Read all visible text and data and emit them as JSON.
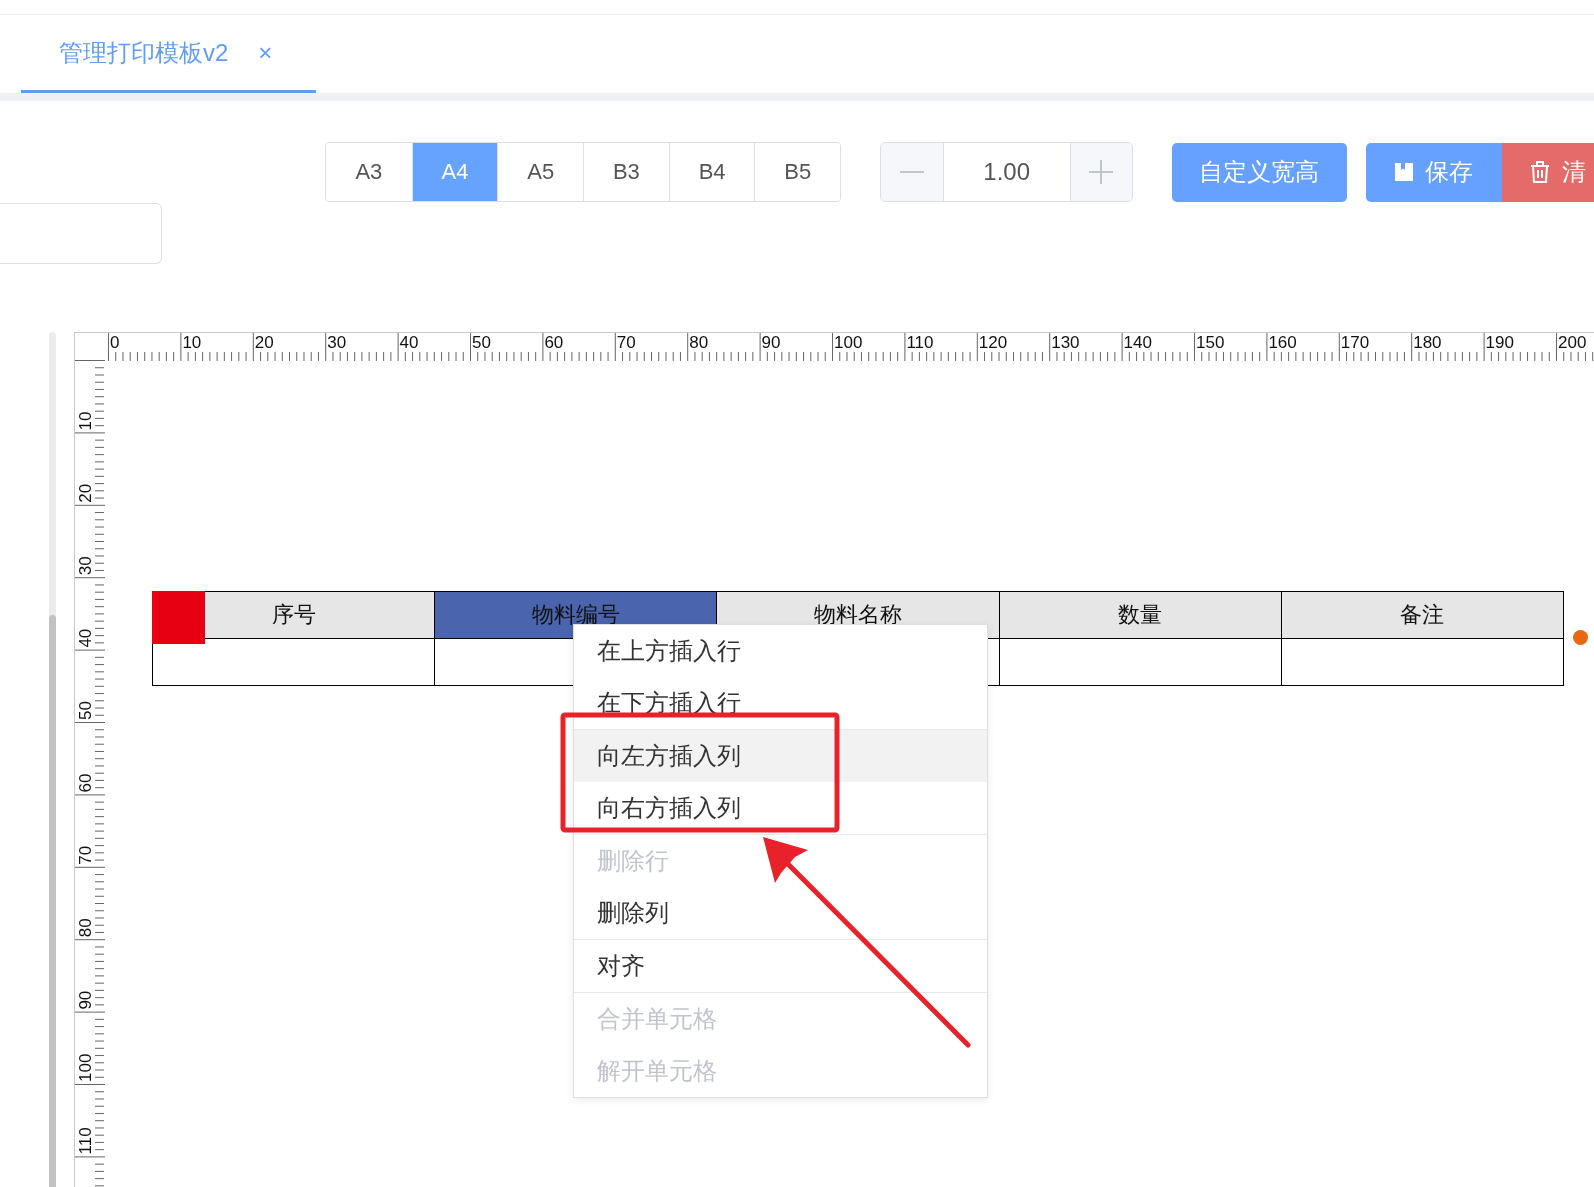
{
  "tabs": [
    {
      "label": "管理打印模板v2",
      "close": "×",
      "selected": true
    }
  ],
  "paper_sizes": [
    {
      "label": "A3",
      "selected": false
    },
    {
      "label": "A4",
      "selected": true
    },
    {
      "label": "A5",
      "selected": false
    },
    {
      "label": "B3",
      "selected": false
    },
    {
      "label": "B4",
      "selected": false
    },
    {
      "label": "B5",
      "selected": false
    }
  ],
  "scale": {
    "value": "1.00"
  },
  "buttons": [
    {
      "kind": "primary",
      "label": "自定义宽高"
    },
    {
      "kind": "save",
      "label": "保存"
    },
    {
      "kind": "clear",
      "label": "清"
    }
  ],
  "ruler": {
    "top_labels": [
      "0",
      "10",
      "20",
      "30",
      "40",
      "50",
      "60",
      "70",
      "80",
      "90",
      "100",
      "110",
      "120",
      "130",
      "140",
      "150",
      "160",
      "170",
      "180",
      "190",
      "200"
    ],
    "left_labels": [
      "10",
      "20",
      "30",
      "40",
      "50",
      "60",
      "70",
      "80",
      "90",
      "100",
      "110"
    ]
  },
  "table": {
    "columns": [
      {
        "label": "序号",
        "selected": false
      },
      {
        "label": "物料编号",
        "selected": true
      },
      {
        "label": "物料名称",
        "selected": false
      },
      {
        "label": "数量",
        "selected": false
      },
      {
        "label": "备注",
        "selected": false
      }
    ],
    "rows": [
      {
        "kind": "empty"
      }
    ]
  },
  "context_menu": {
    "groups": [
      [
        {
          "label": "在上方插入行",
          "disabled": false,
          "hovered": false
        },
        {
          "label": "在下方插入行",
          "disabled": false,
          "hovered": false
        }
      ],
      [
        {
          "label": "向左方插入列",
          "disabled": false,
          "hovered": true
        },
        {
          "label": "向右方插入列",
          "disabled": false,
          "hovered": false
        }
      ],
      [
        {
          "label": "删除行",
          "disabled": true,
          "hovered": false
        },
        {
          "label": "删除列",
          "disabled": false,
          "hovered": false
        }
      ],
      [
        {
          "label": "对齐",
          "disabled": false,
          "hovered": false
        }
      ],
      [
        {
          "label": "合并单元格",
          "disabled": true,
          "hovered": false
        },
        {
          "label": "解开单元格",
          "disabled": true,
          "hovered": false
        }
      ]
    ]
  },
  "annotation": {
    "kind": "box-with-arrow"
  }
}
